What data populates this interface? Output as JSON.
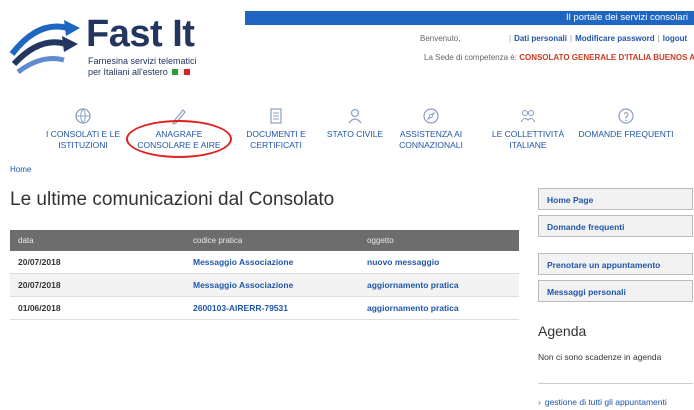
{
  "brand": {
    "title": "Fast It",
    "subtitle": "Farnesina servizi telematici per Italiani all'estero",
    "flag_colors": [
      "#2e9a3a",
      "#ffffff",
      "#d2232a"
    ]
  },
  "topbar": {
    "text": "Il portale dei servizi consolari"
  },
  "user": {
    "welcome": "Benvenuto,",
    "links": [
      "Dati personali",
      "Modificare password",
      "logout"
    ],
    "seat_label": "La Sede di competenza è:",
    "seat_value": "CONSOLATO GENERALE D'ITALIA BUENOS AIRES"
  },
  "nav": [
    {
      "label": "I CONSOLATI E LE ISTITUZIONI",
      "icon": "globe-icon"
    },
    {
      "label": "ANAGRAFE CONSOLARE E AIRE",
      "icon": "pencil-icon"
    },
    {
      "label": "DOCUMENTI E CERTIFICATI",
      "icon": "document-icon"
    },
    {
      "label": "STATO CIVILE",
      "icon": "person-icon"
    },
    {
      "label": "ASSISTENZA AI CONNAZIONALI",
      "icon": "compass-icon"
    },
    {
      "label": "LE COLLETTIVITÀ ITALIANE",
      "icon": "group-icon"
    },
    {
      "label": "DOMANDE FREQUENTI",
      "icon": "question-icon"
    }
  ],
  "breadcrumb": "Home",
  "page_title": "Le ultime comunicazioni dal Consolato",
  "table": {
    "headers": [
      "data",
      "codice pratica",
      "oggetto"
    ],
    "rows": [
      [
        "20/07/2018",
        "Messaggio Associazione",
        "nuovo messaggio"
      ],
      [
        "20/07/2018",
        "Messaggio Associazione",
        "aggiornamento pratica"
      ],
      [
        "01/06/2018",
        "2600103-AIRERR-79531",
        "aggiornamento pratica"
      ]
    ]
  },
  "sidebar": {
    "buttons": [
      "Home Page",
      "Domande frequenti",
      "Prenotare un appuntamento",
      "Messaggi personali"
    ],
    "agenda_title": "Agenda",
    "agenda_empty": "Non ci sono scadenze in agenda",
    "agenda_link": "gestione di tutti gli appuntamenti"
  },
  "colors": {
    "accent_blue": "#1f66c3",
    "link_blue": "#1f56a8",
    "brand_navy": "#22365f",
    "header_gray": "#6d6d6d",
    "highlight_red": "#e02020",
    "seat_red": "#cc3a1f"
  }
}
